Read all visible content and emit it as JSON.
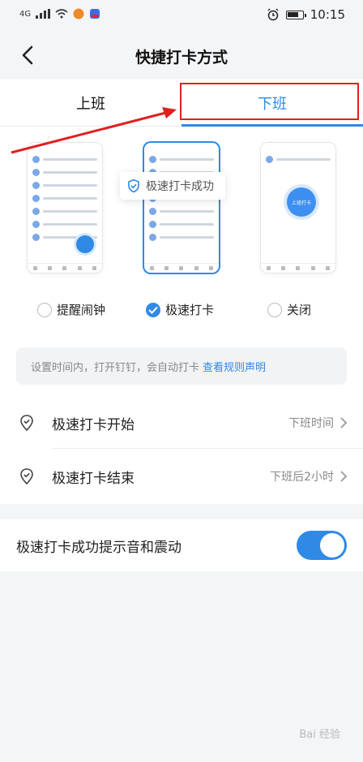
{
  "status_bar": {
    "network": "4G",
    "time": "10:15"
  },
  "header": {
    "title": "快捷打卡方式"
  },
  "tabs": [
    {
      "label": "上班"
    },
    {
      "label": "下班"
    }
  ],
  "preview": {
    "toast": "极速打卡成功",
    "circle_text": "上班打卡"
  },
  "radio_options": [
    {
      "label": "提醒闹钟",
      "selected": false
    },
    {
      "label": "极速打卡",
      "selected": true
    },
    {
      "label": "关闭",
      "selected": false
    }
  ],
  "hint": {
    "text": "设置时间内，打开钉钉，会自动打卡",
    "link": "查看规则声明"
  },
  "settings": [
    {
      "label": "极速打卡开始",
      "value": "下班时间"
    },
    {
      "label": "极速打卡结束",
      "value": "下班后2小时"
    }
  ],
  "toggle": {
    "label": "极速打卡成功提示音和震动",
    "on": true
  },
  "watermark": "Bai 经验",
  "colors": {
    "accent": "#2f8ae6",
    "annotation": "#e02020"
  }
}
